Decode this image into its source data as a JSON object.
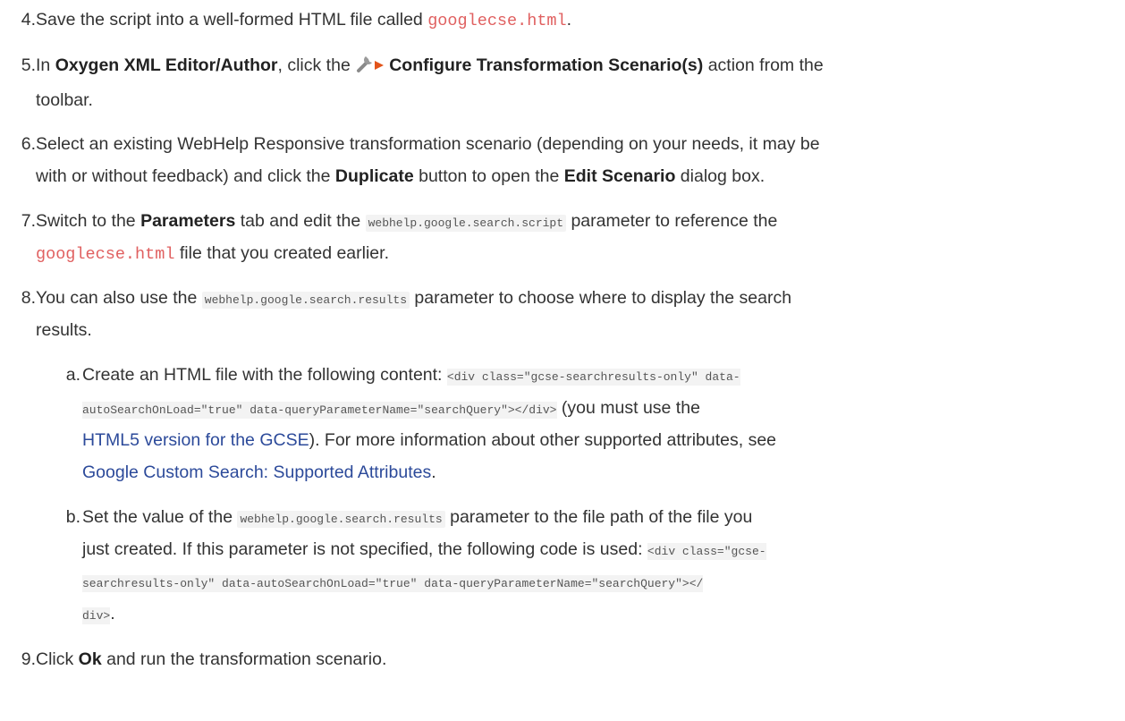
{
  "steps": {
    "s4": {
      "num": "4.",
      "pre": "Save the script into a well-formed HTML file called ",
      "file": "googlecse.html",
      "post": "."
    },
    "s5": {
      "num": "5.",
      "pre": "In ",
      "app": "Oxygen XML Editor/Author",
      "mid": ", click the ",
      "icon_name": "configure-transformation-icon",
      "action": "Configure Transformation Scenario(s)",
      "post": " action from the",
      "line2": "toolbar."
    },
    "s6": {
      "num": "6.",
      "line1": "Select an existing WebHelp Responsive transformation scenario (depending on your needs, it may be",
      "l2a": "with or without feedback) and click the ",
      "dup": "Duplicate",
      "l2b": " button to open the ",
      "edit": "Edit Scenario",
      "l2c": " dialog box."
    },
    "s7": {
      "num": "7.",
      "pre": "Switch to the ",
      "params": "Parameters",
      "mid": " tab and edit the ",
      "code": "webhelp.google.search.script",
      "post": " parameter to reference the",
      "file": "googlecse.html",
      "line2": " file that you created earlier."
    },
    "s8": {
      "num": "8.",
      "pre": "You can also use the ",
      "code": "webhelp.google.search.results",
      "post": " parameter to choose where to display the search",
      "line2": "results."
    },
    "s8a": {
      "num": "a.",
      "pre": "Create an HTML file with the following content: ",
      "code1": "<div class=\"gcse-searchresults-only\" data-",
      "code2": "autoSearchOnLoad=\"true\" data-queryParameterName=\"searchQuery\"></div>",
      "l2post": " (you must use the",
      "link1": "HTML5 version for the GCSE",
      "l3post": "). For more information about other supported attributes, see",
      "link2": "Google Custom Search: Supported Attributes",
      "l4post": "."
    },
    "s8b": {
      "num": "b.",
      "pre": "Set the value of the ",
      "code": "webhelp.google.search.results",
      "post": " parameter to the file path of the file you",
      "l2": "just created. If this parameter is not specified, the following code is used: ",
      "code2": "<div class=\"gcse-",
      "code3": "searchresults-only\" data-autoSearchOnLoad=\"true\" data-queryParameterName=\"searchQuery\"></",
      "code4": "div>",
      "l4post": "."
    },
    "s9": {
      "num": "9.",
      "pre": "Click ",
      "ok": "Ok",
      "post": " and run the transformation scenario."
    }
  },
  "colors": {
    "text": "#333333",
    "file": "#e06060",
    "link": "#2c4a9a",
    "code_bg": "#f3f3f3"
  }
}
